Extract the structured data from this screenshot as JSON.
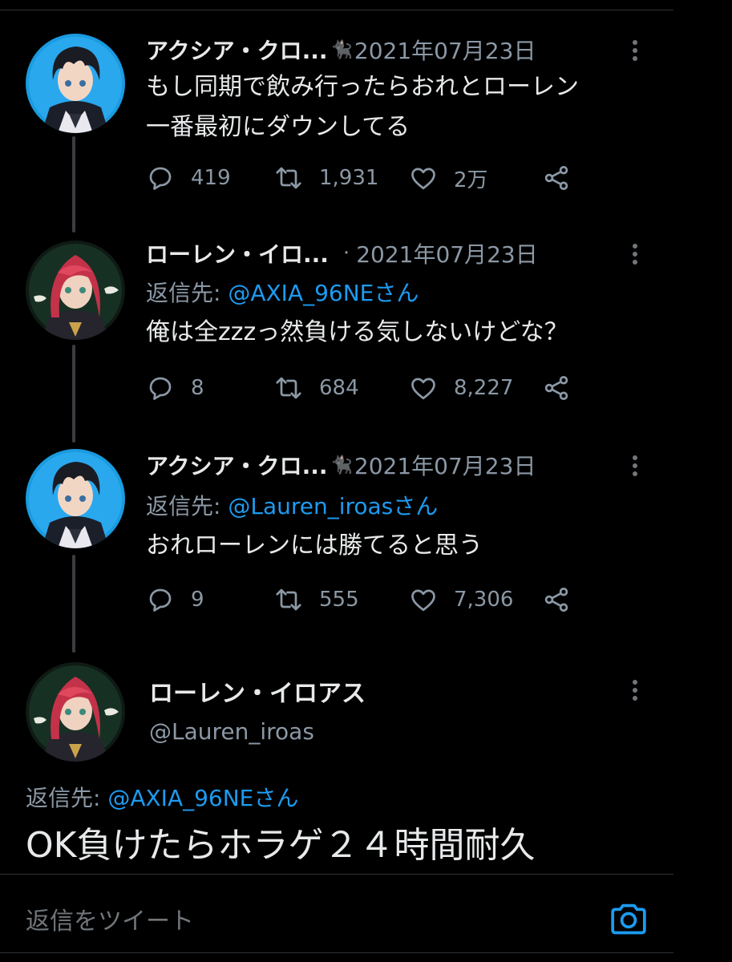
{
  "tweets": [
    {
      "author": "アクシア・クロ...",
      "cat": "🐈‍⬛",
      "date": "2021年07月23日",
      "reply_label": "",
      "reply_handle": "",
      "text_lines": [
        "もし同期で飲み行ったらおれとローレン",
        "一番最初にダウンしてる"
      ],
      "replies": "419",
      "retweets": "1,931",
      "likes": "2万",
      "avatar": "axia"
    },
    {
      "author": "ローレン・イロ...",
      "separator": "·",
      "date": "2021年07月23日",
      "reply_label": "返信先: ",
      "reply_handle": "@AXIA_96NEさん",
      "text_lines": [
        "俺は全zzzっ然負ける気しないけどな？"
      ],
      "replies": "8",
      "retweets": "684",
      "likes": "8,227",
      "avatar": "lauren"
    },
    {
      "author": "アクシア・クロ...",
      "cat": "🐈‍⬛",
      "date": "2021年07月23日",
      "reply_label": "返信先: ",
      "reply_handle": "@Lauren_iroasさん",
      "text_lines": [
        "おれローレンには勝てると思う"
      ],
      "replies": "9",
      "retweets": "555",
      "likes": "7,306",
      "avatar": "axia"
    }
  ],
  "main_tweet": {
    "name": "ローレン・イロアス",
    "handle": "@Lauren_iroas",
    "reply_label": "返信先: ",
    "reply_handle": "@AXIA_96NEさん",
    "text": "OK負けたらホラゲ２４時間耐久"
  },
  "compose": {
    "placeholder": "返信をツイート"
  },
  "colors": {
    "background": "#000000",
    "accent": "#1d9bf0",
    "muted": "#8b98a5",
    "text": "#e7e9ea"
  },
  "icons": [
    "reply-icon",
    "retweet-icon",
    "like-icon",
    "share-icon",
    "more-icon",
    "camera-icon"
  ]
}
